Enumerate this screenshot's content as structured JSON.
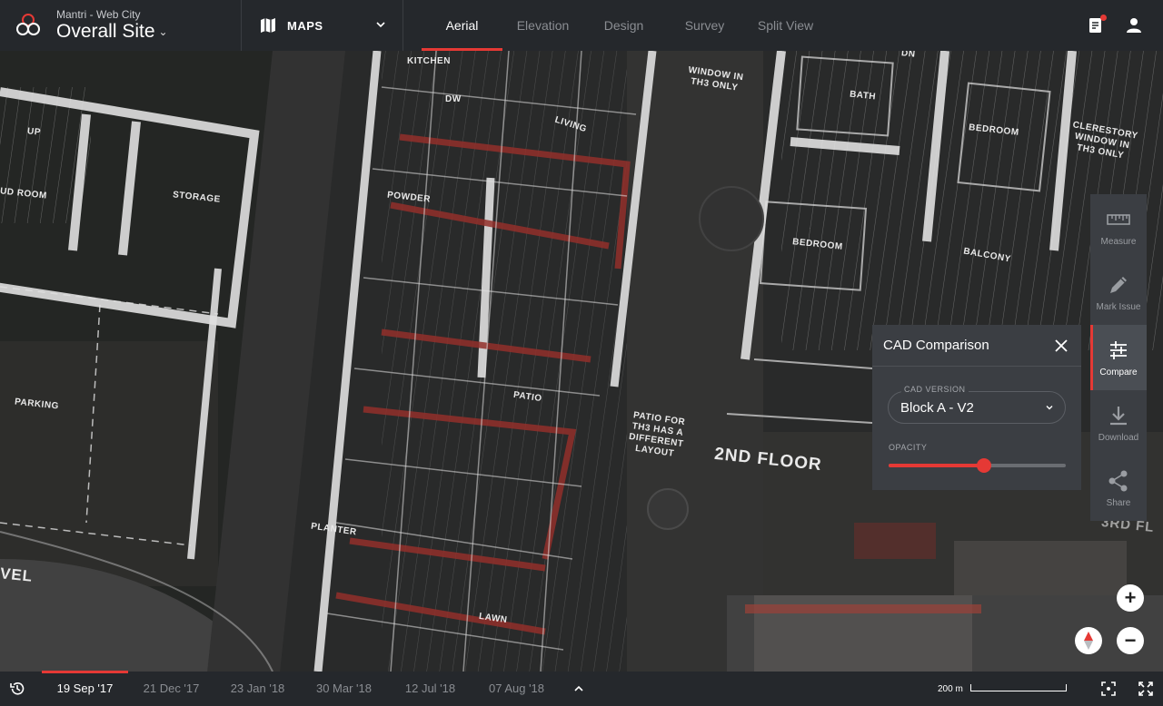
{
  "header": {
    "project_subtitle": "Mantri - Web City",
    "project_title": "Overall Site",
    "maps_label": "MAPS",
    "tabs": [
      {
        "label": "Aerial",
        "active": true
      },
      {
        "label": "Elevation",
        "active": false
      },
      {
        "label": "Design",
        "active": false
      },
      {
        "label": "Survey",
        "active": false
      },
      {
        "label": "Split View",
        "active": false
      }
    ],
    "icons": [
      "notes-icon",
      "user-icon"
    ]
  },
  "map_labels": {
    "kitchen": "KITCHEN",
    "dw": "DW",
    "living": "LIVING",
    "window_note": "WINDOW IN TH3 ONLY",
    "bath": "BATH",
    "bedroom_top": "BEDROOM",
    "clerestory": "CLERESTORY WINDOW IN TH3 ONLY",
    "up": "UP",
    "mud_room": "UD ROOM",
    "storage": "STORAGE",
    "powder": "POWDER",
    "bedroom_mid": "BEDROOM",
    "balcony": "BALCONY",
    "parking": "PARKING",
    "patio": "PATIO",
    "patio_note": "PATIO FOR TH3 HAS A DIFFERENT LAYOUT",
    "second_floor": "2ND FLOOR",
    "planter": "PLANTER",
    "lawn": "LAWN",
    "vel": "VEL",
    "dn": "DN",
    "srd": "3RD FL"
  },
  "rail": [
    {
      "label": "Measure",
      "icon": "ruler-icon",
      "active": false
    },
    {
      "label": "Mark Issue",
      "icon": "pencil-icon",
      "active": false
    },
    {
      "label": "Compare",
      "icon": "compare-icon",
      "active": true
    },
    {
      "label": "Download",
      "icon": "download-icon",
      "active": false
    },
    {
      "label": "Share",
      "icon": "share-icon",
      "active": false
    }
  ],
  "cad_panel": {
    "title": "CAD Comparison",
    "version_label": "CAD VERSION",
    "version_value": "Block A - V2",
    "opacity_label": "OPACITY",
    "opacity": 0.54
  },
  "zoom": {
    "in": "+",
    "out": "−"
  },
  "timeline": {
    "dates": [
      {
        "label": "19 Sep '17",
        "active": true
      },
      {
        "label": "21 Dec '17",
        "active": false
      },
      {
        "label": "23 Jan '18",
        "active": false
      },
      {
        "label": "30 Mar '18",
        "active": false
      },
      {
        "label": "12 Jul '18",
        "active": false
      },
      {
        "label": "07 Aug '18",
        "active": false
      }
    ],
    "scale_label": "200 m"
  },
  "colors": {
    "accent": "#e53935",
    "bar": "#25282c",
    "panel": "#3b3e43"
  }
}
